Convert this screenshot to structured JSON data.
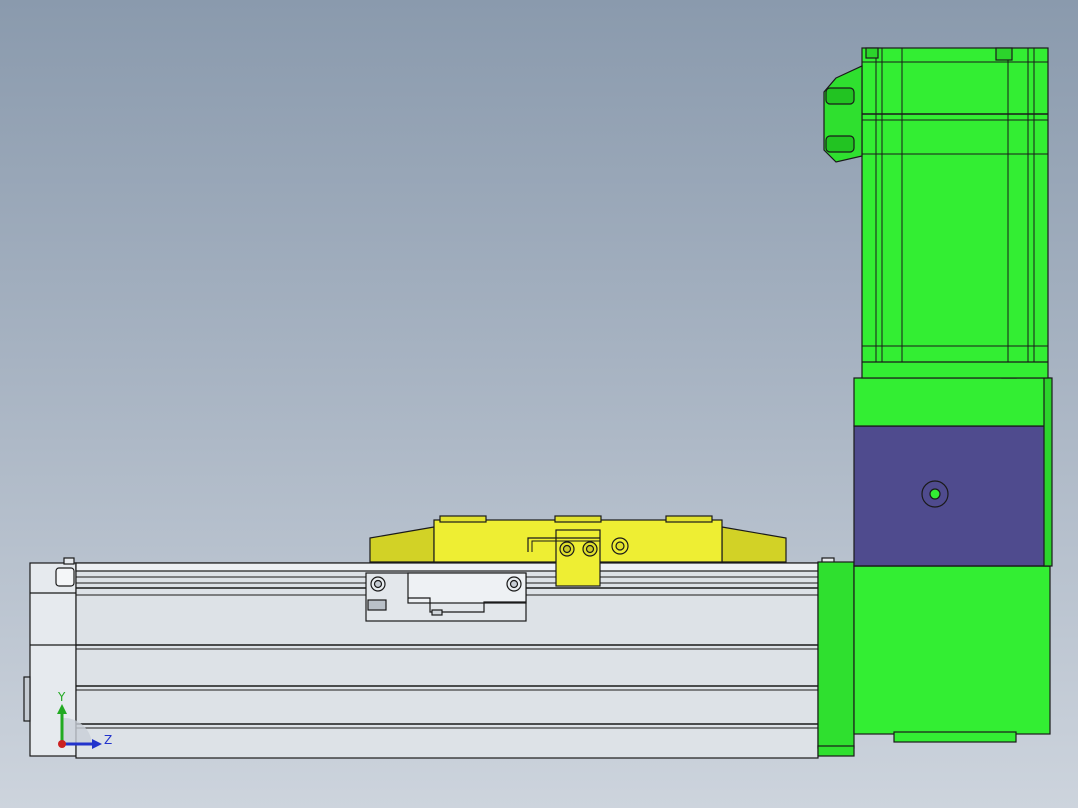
{
  "viewport": {
    "background_top": "#8a9aad",
    "background_bottom": "#cdd4dd"
  },
  "colors": {
    "actuator_body": "#dde2e7",
    "motor": "#33ee33",
    "motor_dark": "#1fb31f",
    "gearbox_band": "#4f4b8e",
    "carriage": "#eeee33",
    "carriage_dark": "#b8b81a",
    "outline": "#1a1a1a"
  },
  "triad": {
    "y_label": "Y",
    "z_label": "Z",
    "y_color": "#22aa22",
    "z_color": "#2233cc",
    "x_color": "#cc2222"
  },
  "parts": {
    "linear_actuator": "linear-actuator-body",
    "carriage": "carriage-slider",
    "motor": "servo-motor",
    "gearbox": "gearbox-housing"
  }
}
